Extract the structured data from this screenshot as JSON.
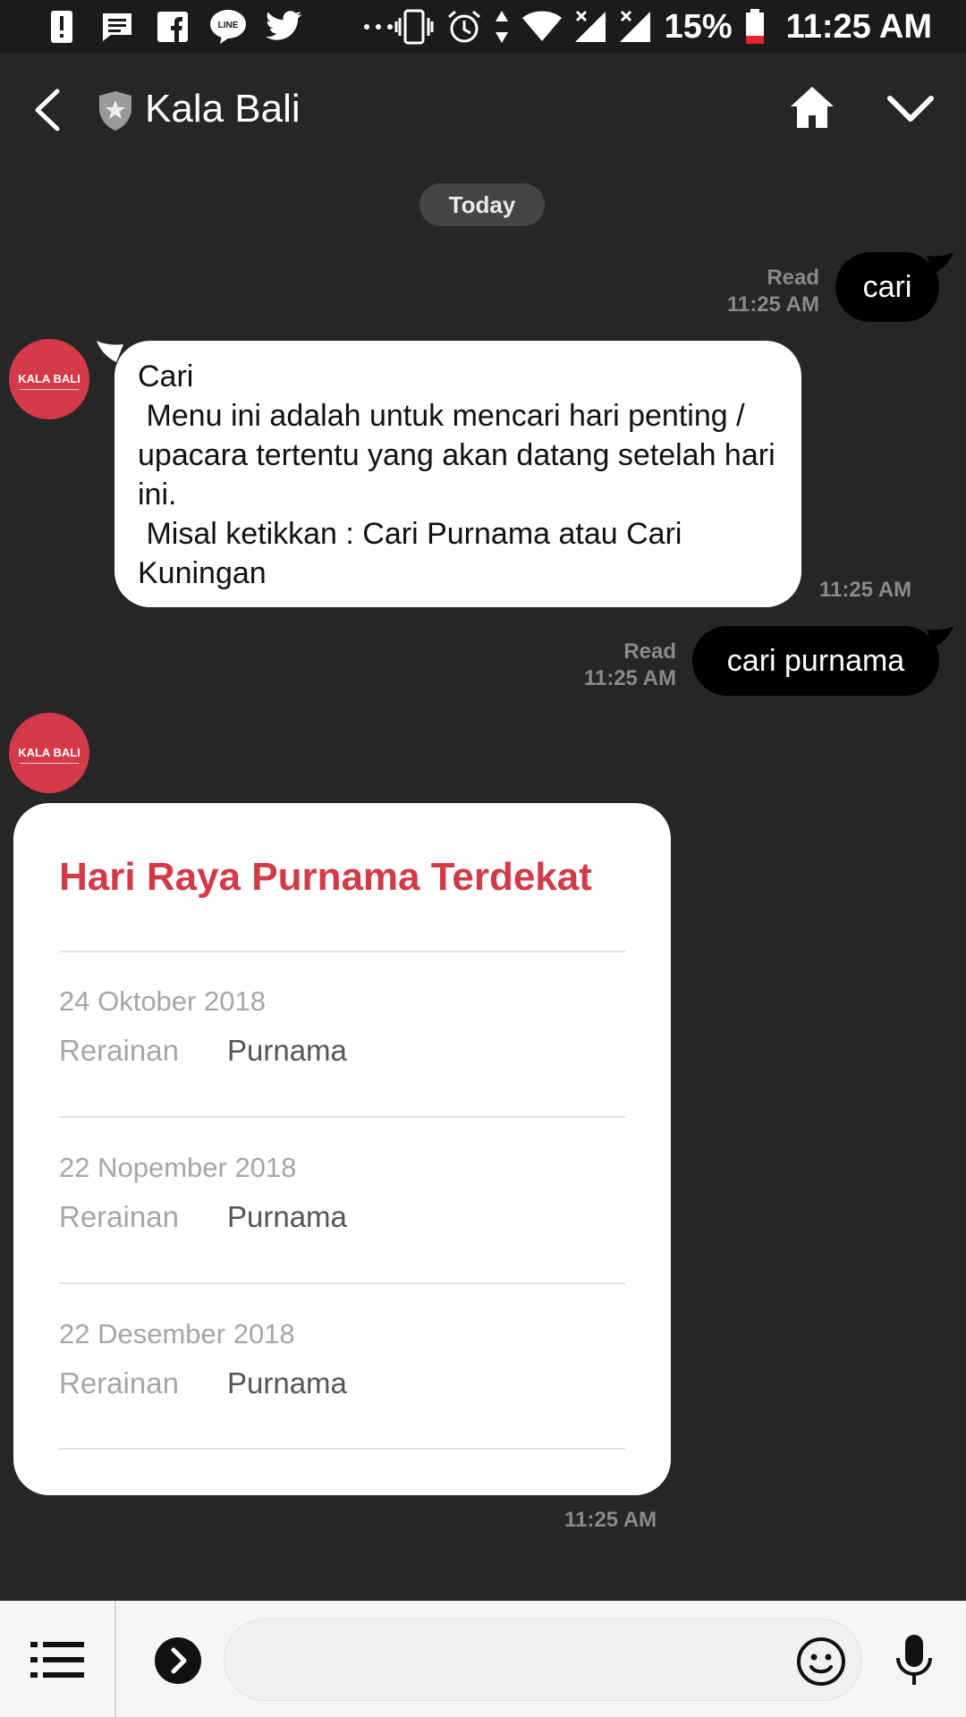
{
  "status_bar": {
    "battery": "15%",
    "time": "11:25 AM",
    "line_badge": "LINE"
  },
  "header": {
    "title": "Kala Bali"
  },
  "chat": {
    "date_label": "Today",
    "messages": [
      {
        "sender": "me",
        "text": "cari",
        "read": "Read",
        "time": "11:25 AM"
      },
      {
        "sender": "Kala Bali",
        "text": "Cari\n Menu ini adalah untuk mencari hari penting / upacara tertentu yang akan datang setelah hari ini.\n Misal ketikkan : Cari Purnama atau Cari Kuningan",
        "time": "11:25 AM"
      },
      {
        "sender": "me",
        "text": "cari purnama",
        "read": "Read",
        "time": "11:25 AM"
      }
    ],
    "avatar_label": "KALA BALI",
    "card": {
      "title": "Hari Raya Purnama Terdekat",
      "rows": [
        {
          "date": "24 Oktober 2018",
          "label": "Rerainan",
          "value": "Purnama"
        },
        {
          "date": "22 Nopember 2018",
          "label": "Rerainan",
          "value": "Purnama"
        },
        {
          "date": "22 Desember 2018",
          "label": "Rerainan",
          "value": "Purnama"
        }
      ],
      "time": "11:25 AM"
    }
  },
  "input_bar": {
    "placeholder": ""
  }
}
